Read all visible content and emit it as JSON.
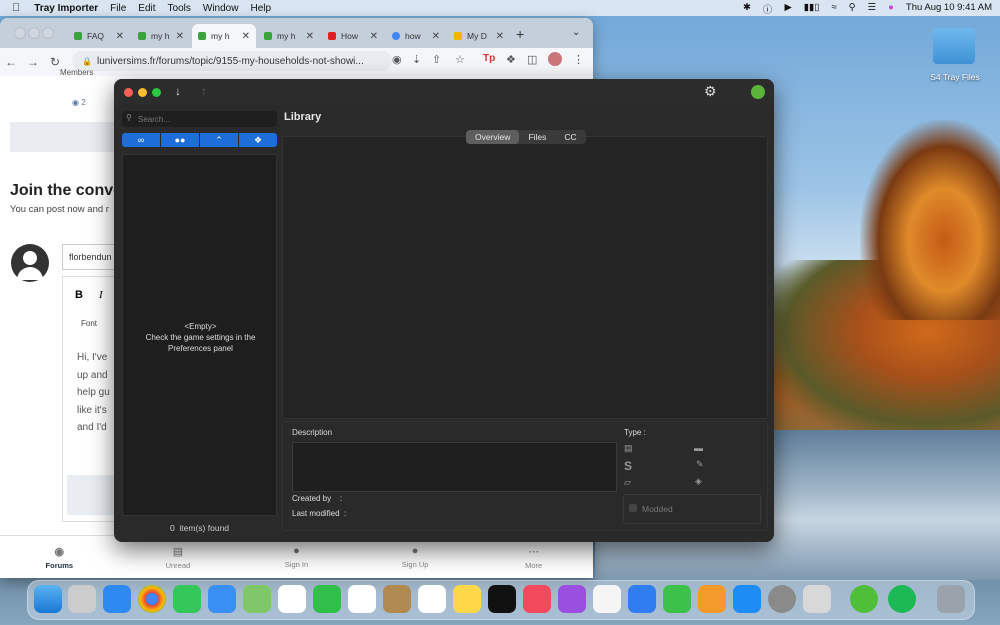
{
  "menubar": {
    "app": "Tray Importer",
    "items": [
      "File",
      "Edit",
      "Tools",
      "Window",
      "Help"
    ],
    "datetime": "Thu Aug 10  9:41 AM"
  },
  "desktop": {
    "folder_label": "S4 Tray Files"
  },
  "browser": {
    "tabs": [
      {
        "label": "FAQ",
        "color": "#3ba33b"
      },
      {
        "label": "my h",
        "color": "#3ba33b"
      },
      {
        "label": "my h",
        "color": "#3ba33b",
        "active": true
      },
      {
        "label": "my h",
        "color": "#3ba33b"
      },
      {
        "label": "How",
        "color": "#e02020"
      },
      {
        "label": "how",
        "color": "#4285f4"
      },
      {
        "label": "My D",
        "color": "#f4b400"
      }
    ],
    "url": "luniversims.fr/forums/topic/9155-my-households-not-showi...",
    "page": {
      "members_label": "Members",
      "reply_count": "2",
      "join_title": "Join the conve",
      "join_sub": "You can post now and r",
      "username_value": "florbendun",
      "font_label": "Font",
      "editor_lines": [
        "Hi, I've",
        "up and",
        "help gu",
        "like it's",
        "and I'd"
      ]
    },
    "bottom_nav": [
      "Forums",
      "Unread",
      "Sign In",
      "Sign Up",
      "More"
    ]
  },
  "tray": {
    "search_placeholder": "Search...",
    "library_title": "Library",
    "tabs": [
      "Overview",
      "Files",
      "CC"
    ],
    "empty_title": "<Empty>",
    "empty_line1": "Check the game settings in the",
    "empty_line2": "Preferences panel",
    "found_count": "0",
    "found_label": "item(s) found",
    "description_label": "Description",
    "created_label": "Created by",
    "created_sep": ":",
    "modified_label": "Last modified",
    "modified_sep": ":",
    "type_label": "Type :",
    "modded_label": "Modded"
  }
}
